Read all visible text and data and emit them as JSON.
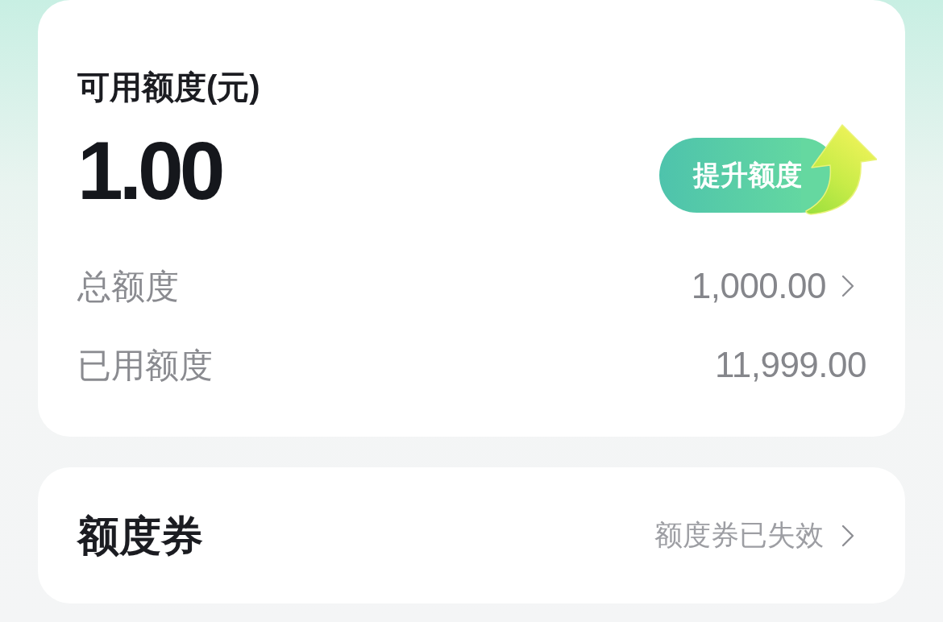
{
  "credit": {
    "label": "可用额度(元)",
    "amount": "1.00",
    "button": "提升额度",
    "rows": [
      {
        "label": "总额度",
        "value": "1,000.00",
        "kind": "link"
      },
      {
        "label": "已用额度",
        "value": "11,999.00",
        "kind": "plain"
      }
    ]
  },
  "voucher": {
    "title": "额度券",
    "status": "额度券已失效"
  }
}
